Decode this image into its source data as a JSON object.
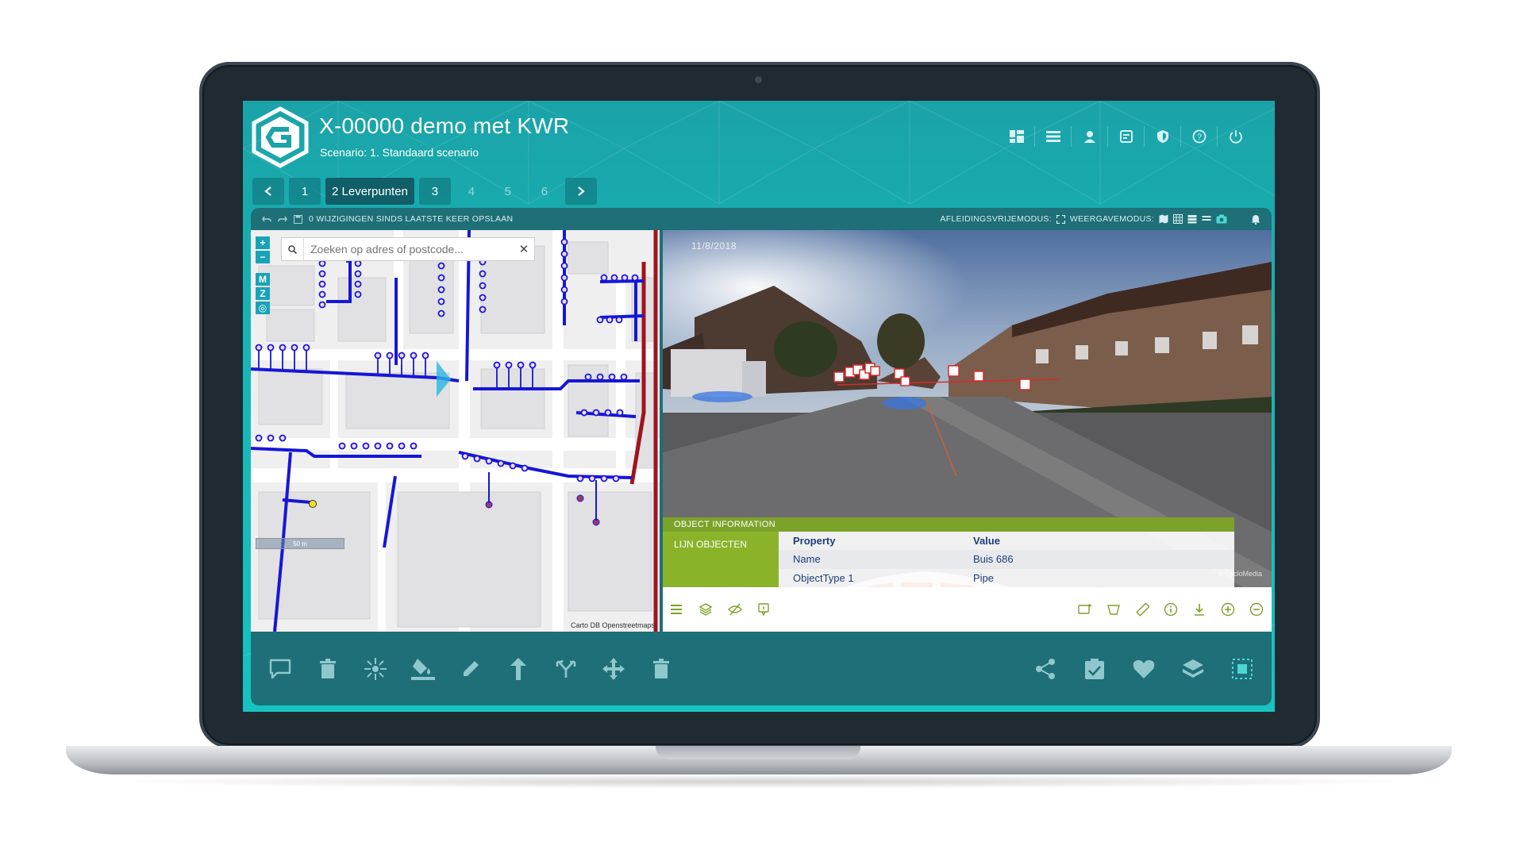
{
  "app": {
    "title": "X-00000 demo met KWR",
    "scenario": "Scenario: 1. Standaard scenario"
  },
  "header_icons": [
    "dashboard-icon",
    "list-icon",
    "user-icon",
    "report-icon",
    "shield-icon",
    "help-icon",
    "power-icon"
  ],
  "steps": [
    {
      "label": "1",
      "state": "normal"
    },
    {
      "label": "2 Leverpunten",
      "state": "active"
    },
    {
      "label": "3",
      "state": "normal"
    },
    {
      "label": "4",
      "state": "dim"
    },
    {
      "label": "5",
      "state": "dim"
    },
    {
      "label": "6",
      "state": "dim"
    }
  ],
  "topbar": {
    "changes": "0 WIJZIGINGEN SINDS LAATSTE KEER OPSLAAN",
    "derivation_mode": "AFLEIDINGSVRIJEMODUS:",
    "display_mode": "WEERGAVEMODUS:"
  },
  "map": {
    "search_placeholder": "Zoeken op adres of postcode...",
    "controls": [
      "+",
      "−",
      "M",
      "Z",
      "◎"
    ],
    "scale": "50 m",
    "credit": "Carto DB Openstreetmaps"
  },
  "streetview": {
    "date": "11/8/2018",
    "credit": "© CycloMedia"
  },
  "object_info": {
    "header": "OBJECT INFORMATION",
    "category": "LIJN OBJECTEN",
    "columns": [
      "Property",
      "Value"
    ],
    "rows": [
      {
        "property": "Name",
        "value": "Buis 686"
      },
      {
        "property": "ObjectType 1",
        "value": "Pipe"
      }
    ]
  },
  "colors": {
    "accent": "#17b6b6",
    "pipe_blue": "#1616d6",
    "pipe_red": "#a0141e",
    "info_green": "#8ab32a"
  }
}
